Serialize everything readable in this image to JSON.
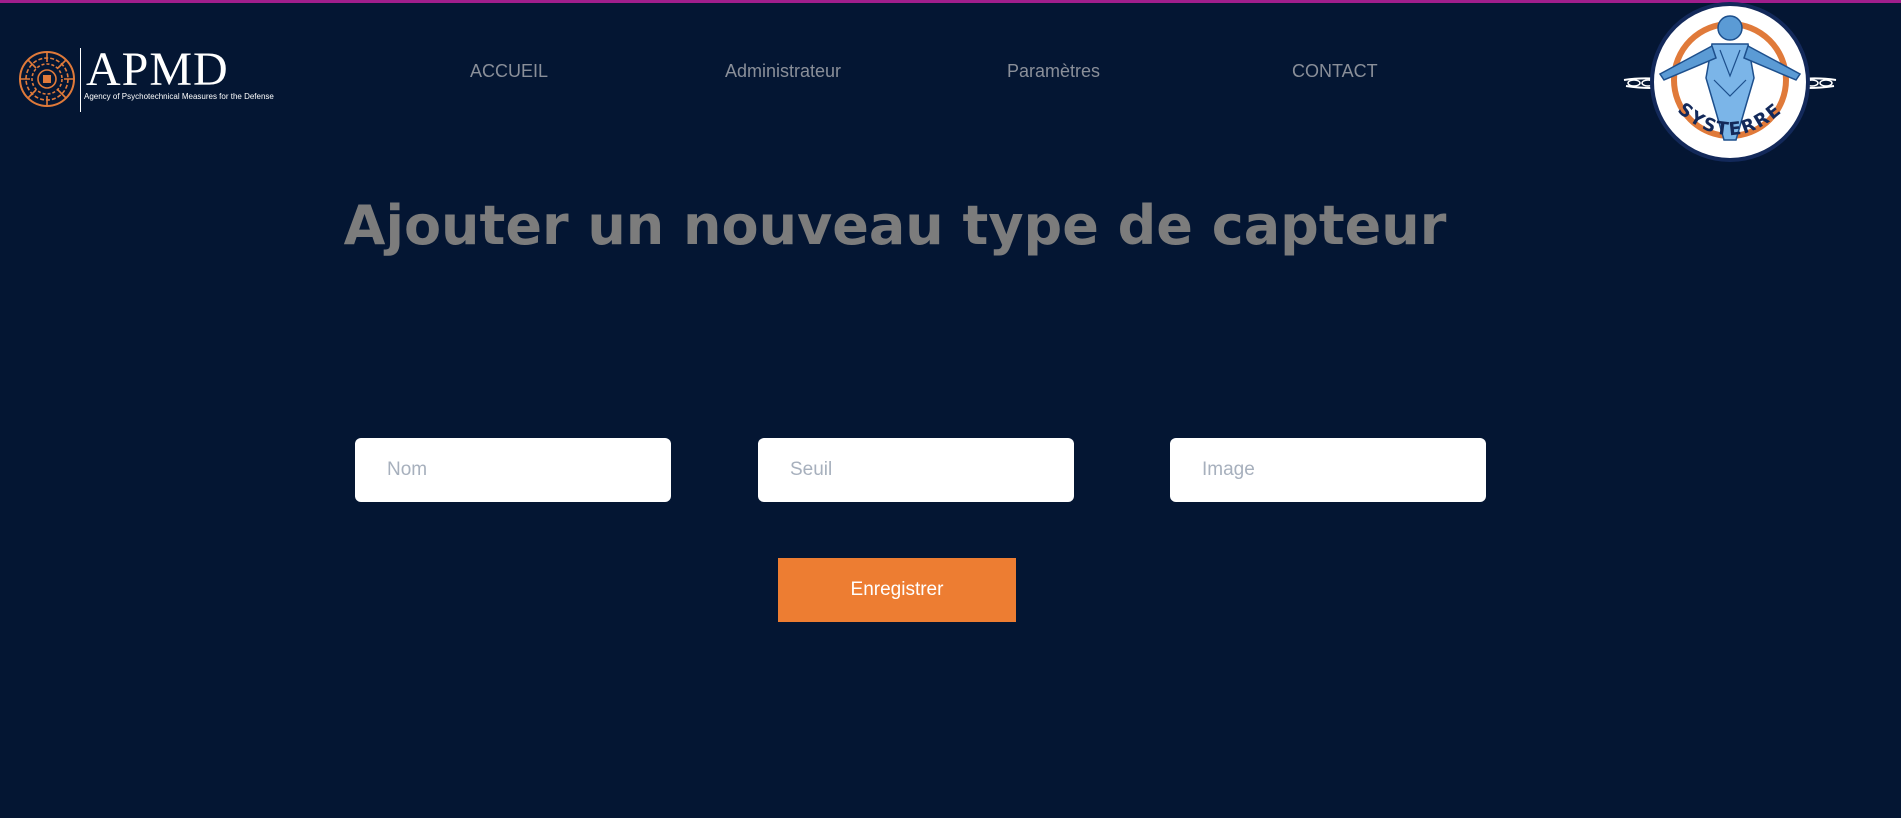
{
  "brand": {
    "name": "APMD",
    "tagline": "Agency of Psychotechnical Measures for the Defense",
    "mark_color": "#e07a3a"
  },
  "nav": {
    "items": [
      {
        "label": "ACCUEIL"
      },
      {
        "label": "Administrateur"
      },
      {
        "label": "Paramètres"
      },
      {
        "label": "CONTACT"
      }
    ]
  },
  "emblem": {
    "text": "SYSTERRE",
    "icon": "human-figure-logo"
  },
  "main": {
    "title": "Ajouter un nouveau type de capteur",
    "form": {
      "nom": {
        "placeholder": "Nom",
        "value": ""
      },
      "seuil": {
        "placeholder": "Seuil",
        "value": ""
      },
      "image": {
        "placeholder": "Image",
        "value": ""
      },
      "submit_label": "Enregistrer"
    }
  },
  "colors": {
    "background": "#041633",
    "accent": "#ed7d32",
    "top_line": "#a01e8c",
    "title": "#7c7c7c",
    "nav_text": "#8a8f99"
  }
}
